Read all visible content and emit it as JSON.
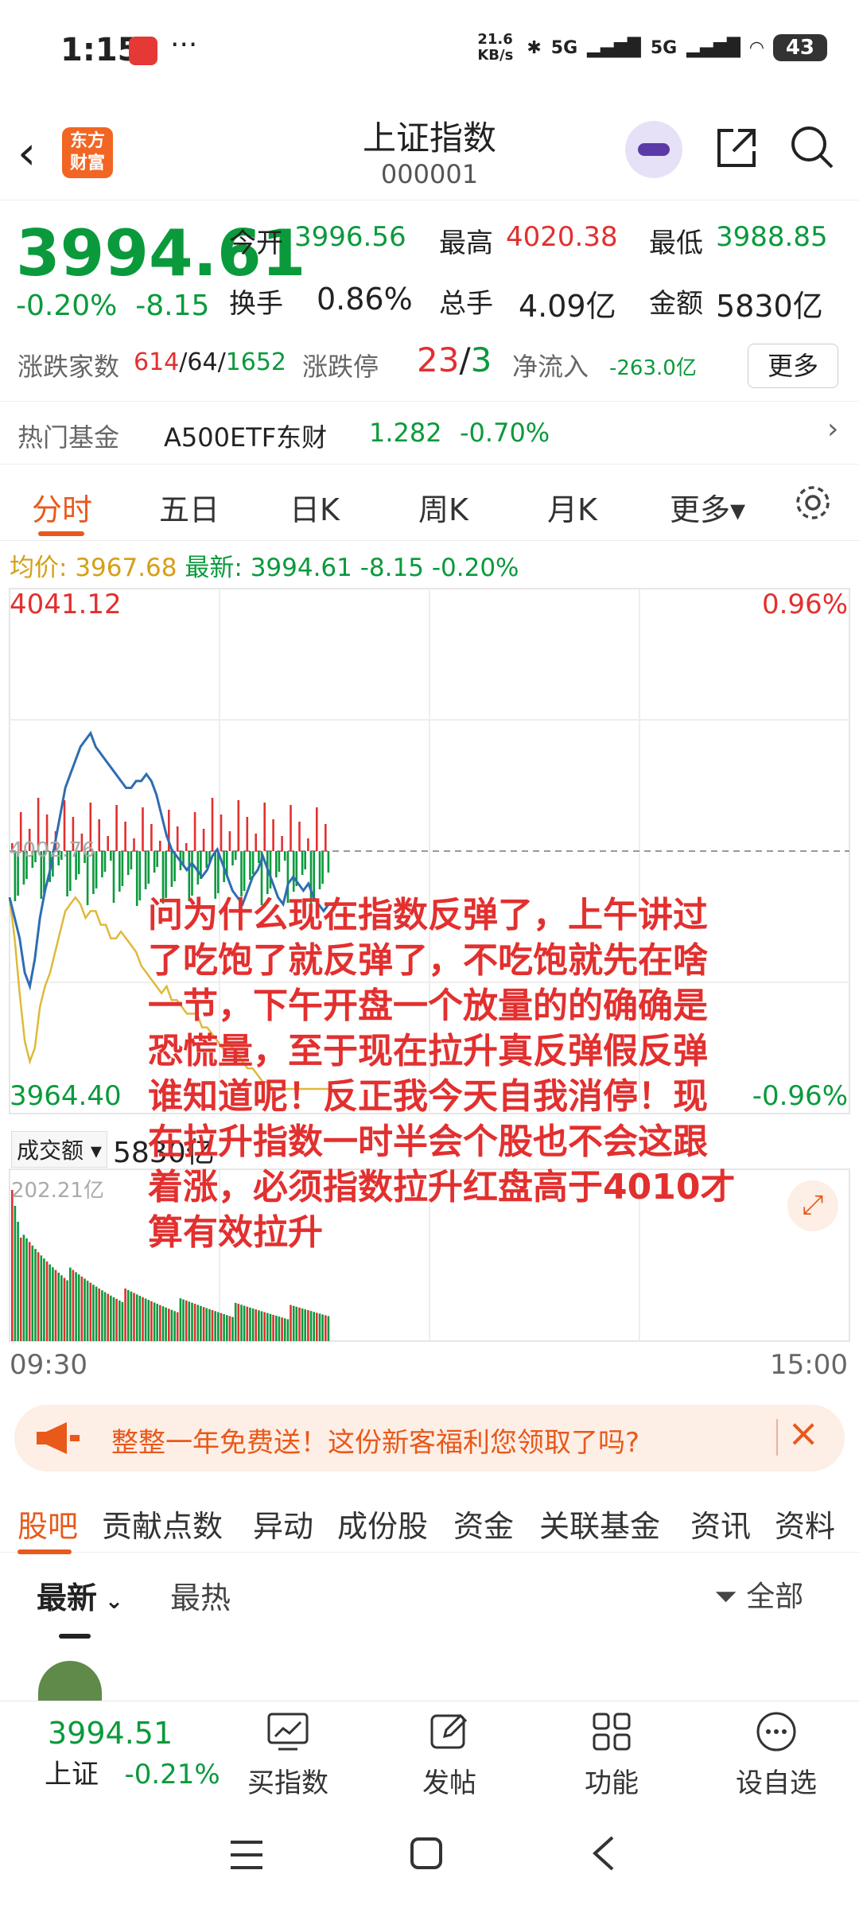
{
  "status": {
    "time": "1:15",
    "net_speed": "21.6 KB/s",
    "signal1": "5G",
    "signal2": "5G",
    "battery": "43"
  },
  "header": {
    "title": "上证指数",
    "code": "000001",
    "logo_text": "东方财富"
  },
  "quote": {
    "price": "3994.61",
    "change_pct": "-0.20%",
    "change": "-8.15",
    "open_label": "今开",
    "open": "3996.56",
    "high_label": "最高",
    "high": "4020.38",
    "low_label": "最低",
    "low": "3988.85",
    "turnover_label": "换手",
    "turnover": "0.86%",
    "volume_label": "总手",
    "volume": "4.09亿",
    "amount_label": "金额",
    "amount": "5830亿",
    "breadth_label": "涨跌家数",
    "up": "614",
    "flat": "64",
    "down": "1652",
    "limit_label": "涨跌停",
    "limit_up": "23",
    "limit_down": "3",
    "netflow_label": "净流入",
    "netflow": "-263.0亿",
    "more_label": "更多"
  },
  "fund": {
    "label": "热门基金",
    "name": "A500ETF东财",
    "price": "1.282",
    "change": "-0.70%"
  },
  "tabs": [
    {
      "label": "分时"
    },
    {
      "label": "五日"
    },
    {
      "label": "日K"
    },
    {
      "label": "周K"
    },
    {
      "label": "月K"
    },
    {
      "label": "更多▾"
    }
  ],
  "avg_line": {
    "avg_label": "均价:",
    "avg": "3967.68",
    "last_label": "最新:",
    "last": "3994.61",
    "chg": "-8.15",
    "pct": "-0.20%"
  },
  "chart_data": {
    "type": "line",
    "y_top": "4041.12",
    "y_bottom": "3964.40",
    "pct_top": "0.96%",
    "pct_bottom": "-0.96%",
    "prev_close_label": "4002.76",
    "ylim": [
      3964.4,
      4041.12
    ],
    "price": [
      3996,
      3993,
      3990,
      3985,
      3983,
      3987,
      3993,
      3997,
      4000,
      4004,
      4008,
      4012,
      4014,
      4016,
      4018,
      4019,
      4020,
      4018,
      4017,
      4016,
      4015,
      4014,
      4013,
      4012,
      4012,
      4013,
      4013,
      4014,
      4013,
      4011,
      4008,
      4005,
      4003,
      4002,
      4001,
      4000,
      4001,
      4000,
      3999,
      4000,
      4002,
      4003,
      4001,
      3999,
      3997,
      3996,
      3995,
      3997,
      3999,
      4000,
      4002,
      4000,
      3998,
      3996,
      3995,
      3998,
      3999,
      3998,
      3997,
      3998,
      3996,
      3995,
      3994,
      3995
    ],
    "avg": [
      3996,
      3990,
      3982,
      3975,
      3972,
      3974,
      3980,
      3983,
      3985,
      3988,
      3991,
      3994,
      3995,
      3996,
      3995,
      3993,
      3994,
      3994,
      3992,
      3992,
      3990,
      3990,
      3991,
      3990,
      3989,
      3988,
      3986,
      3985,
      3984,
      3983,
      3982,
      3983,
      3981,
      3981,
      3980,
      3979,
      3979,
      3979,
      3977,
      3977,
      3976,
      3975,
      3974,
      3975,
      3974,
      3973,
      3972,
      3971,
      3971,
      3970,
      3969,
      3969,
      3968,
      3968,
      3968,
      3968,
      3968,
      3968,
      3968,
      3968,
      3968,
      3968,
      3968,
      3968
    ],
    "volume_label": "成交额",
    "volume_total": "5830亿",
    "volume_max": "202.21亿",
    "x_start": "09:30",
    "x_end": "15:00"
  },
  "annotation": "问为什么现在指数反弹了，上午讲过了吃饱了就反弹了，不吃饱就先在啥一节，下午开盘一个放量的的确确是恐慌量，至于现在拉升真反弹假反弹谁知道呢！反正我今天自我消停！现在拉升指数一时半会个股也不会这跟着涨，必须指数拉升红盘高于4010才算有效拉升",
  "banner": {
    "text": "整整一年免费送！这份新客福利您领取了吗?"
  },
  "subtabs": [
    {
      "label": "股吧"
    },
    {
      "label": "贡献点数"
    },
    {
      "label": "异动"
    },
    {
      "label": "成份股"
    },
    {
      "label": "资金"
    },
    {
      "label": "关联基金"
    },
    {
      "label": "资讯"
    },
    {
      "label": "资料"
    }
  ],
  "sort": {
    "latest": "最新",
    "hot": "最热",
    "filter": "全部"
  },
  "bottom": {
    "index_price": "3994.51",
    "index_name": "上证",
    "index_pct": "-0.21%",
    "buy": "买指数",
    "post": "发帖",
    "func": "功能",
    "watch": "设自选"
  },
  "colors": {
    "up": "#e2302f",
    "down": "#0a9a3c",
    "accent": "#e85a1c",
    "price_line": "#2f6db0",
    "avg_line": "#d4a017"
  }
}
